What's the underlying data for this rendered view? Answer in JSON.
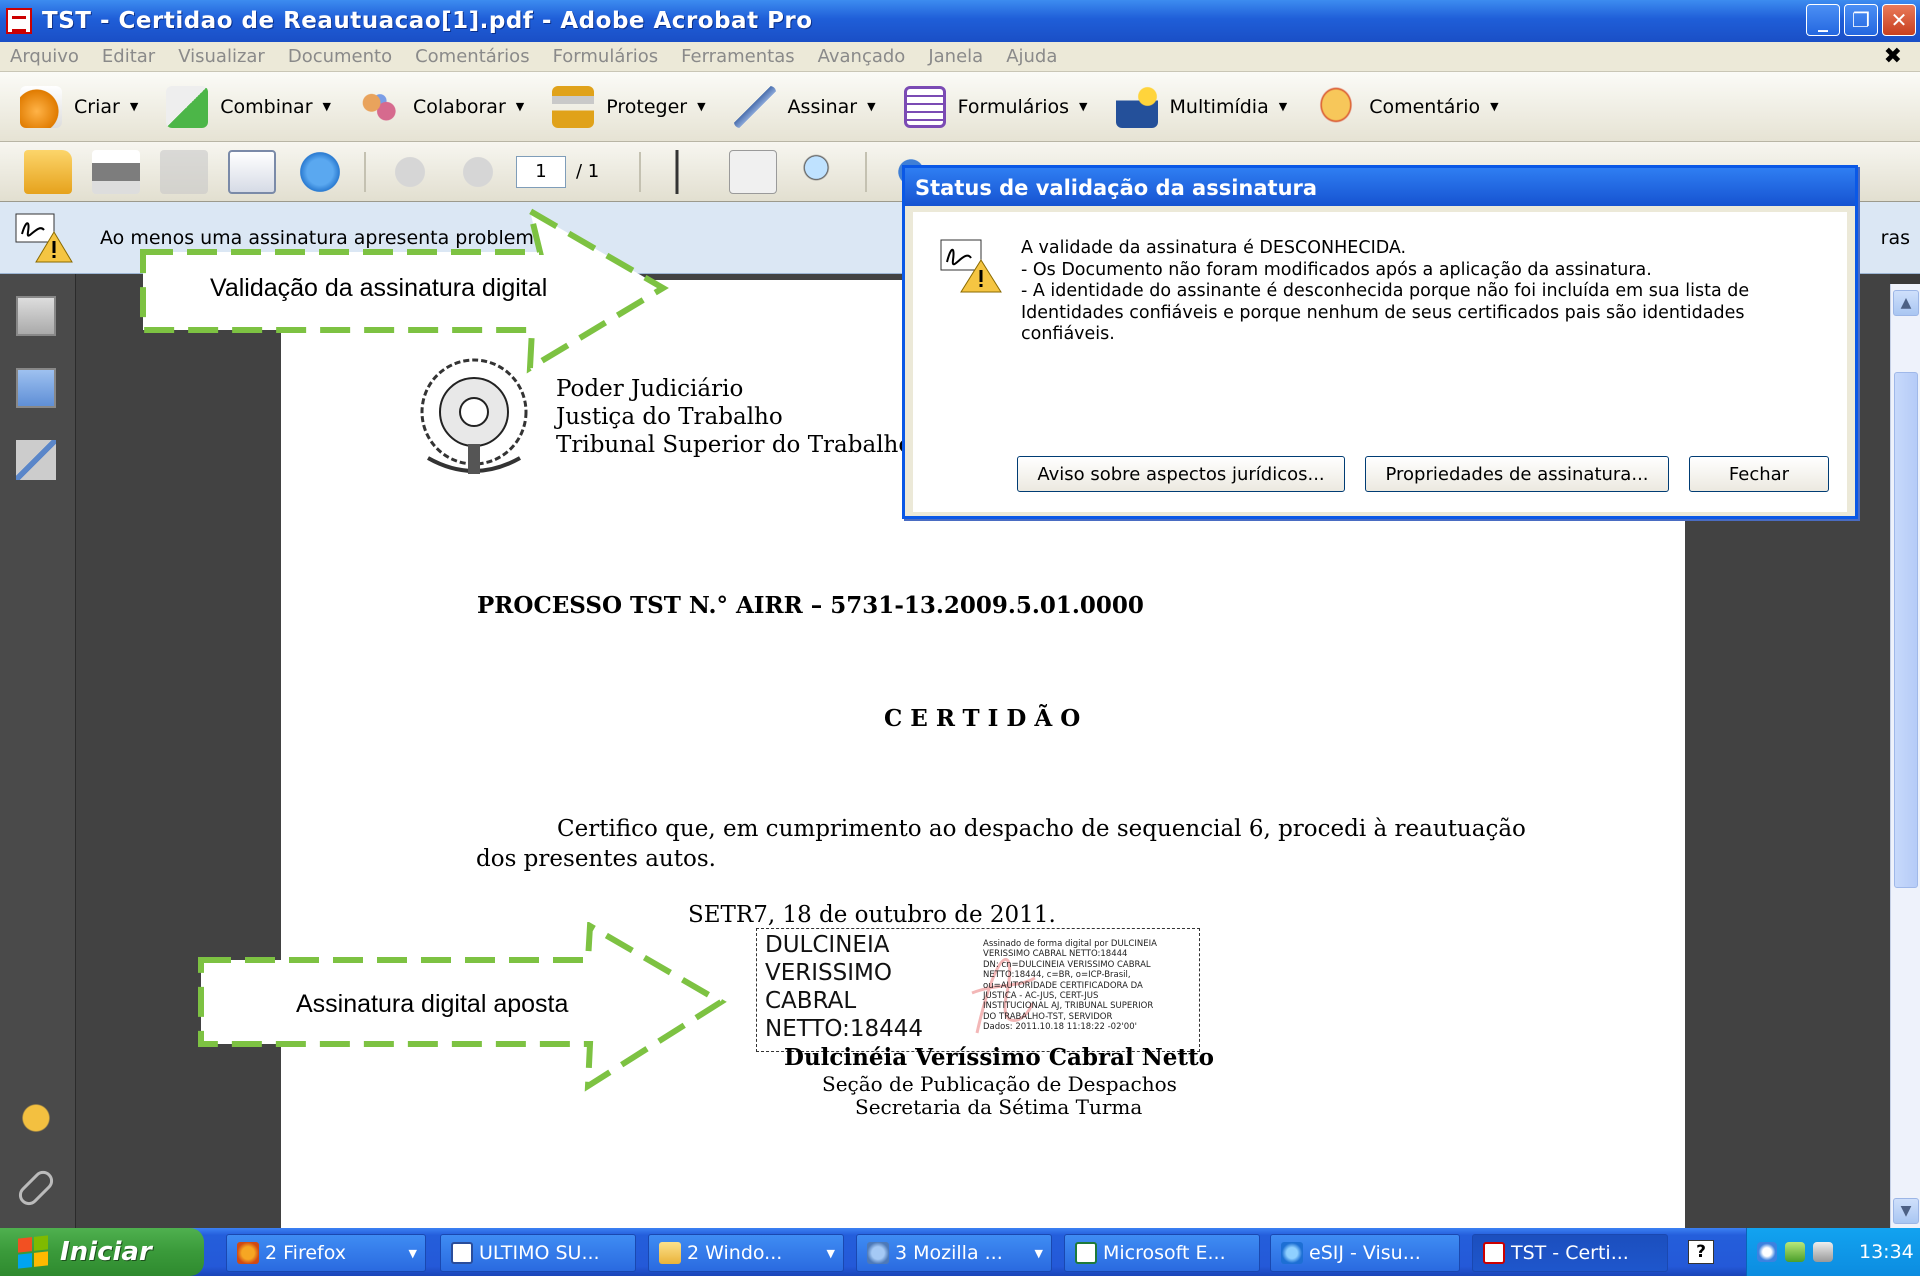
{
  "window": {
    "title": "TST - Certidao de Reautuacao[1].pdf - Adobe Acrobat Pro",
    "minimize": "_",
    "restore": "❐",
    "close": "✕"
  },
  "menu": {
    "items": [
      "Arquivo",
      "Editar",
      "Visualizar",
      "Documento",
      "Comentários",
      "Formulários",
      "Ferramentas",
      "Avançado",
      "Janela",
      "Ajuda"
    ],
    "close_doc": "✖"
  },
  "toolbar": {
    "tasks": [
      {
        "label": "Criar",
        "icon": "create-pdf-icon"
      },
      {
        "label": "Combinar",
        "icon": "combine-files-icon"
      },
      {
        "label": "Colaborar",
        "icon": "collaborate-icon"
      },
      {
        "label": "Proteger",
        "icon": "padlock-icon"
      },
      {
        "label": "Assinar",
        "icon": "pen-icon"
      },
      {
        "label": "Formulários",
        "icon": "forms-icon"
      },
      {
        "label": "Multimídia",
        "icon": "multimedia-icon"
      },
      {
        "label": "Comentário",
        "icon": "comment-bubble-icon"
      }
    ],
    "page_number": "1",
    "page_total": "/ 1"
  },
  "notification": {
    "text": "Ao menos uma assinatura apresenta problemas.",
    "right_text": "ras"
  },
  "document": {
    "header": [
      "Poder Judiciário",
      "Justiça do Trabalho",
      "Tribunal Superior do Trabalho"
    ],
    "process": "PROCESSO TST N.° AIRR – 5731-13.2009.5.01.0000",
    "heading": "CERTIDÃO",
    "body_line1": "Certifico que, em cumprimento ao despacho de sequencial 6, procedi à reautuação",
    "body_line2": "dos presentes autos.",
    "date_line": "SETR7, 18  de outubro de 2011.",
    "signature": {
      "name": "DULCINEIA\nVERISSIMO\nCABRAL\nNETTO:18444",
      "details": "Assinado de forma digital por DULCINEIA\nVERISSIMO CABRAL NETTO:18444\nDN: cn=DULCINEIA VERISSIMO CABRAL\nNETTO:18444, c=BR, o=ICP-Brasil,\nou=AUTORIDADE CERTIFICADORA DA\nJUSTICA - AC-JUS, CERT-JUS\nINSTITUCIONAL AJ, TRIBUNAL SUPERIOR\nDO TRABALHO-TST, SERVIDOR\nDados: 2011.10.18 11:18:22 -02'00'"
    },
    "signer": "Dulcinéia Veríssimo Cabral Netto",
    "section1": "Seção de Publicação de Despachos",
    "section2": "Secretaria da Sétima Turma"
  },
  "callouts": {
    "top": "Validação da assinatura digital",
    "bottom": "Assinatura digital aposta",
    "color": "#7dc242"
  },
  "dialog": {
    "title": "Status de validação da assinatura",
    "line1": "A validade da assinatura é DESCONHECIDA.",
    "line2": "- Os Documento não foram modificados após a aplicação da assinatura.",
    "line3": "- A identidade do assinante é desconhecida porque não foi incluída em sua lista de Identidades confiáveis e porque nenhum de seus certificados pais são identidades confiáveis.",
    "btn_legal": "Aviso sobre aspectos jurídicos...",
    "btn_props": "Propriedades de assinatura...",
    "btn_close": "Fechar"
  },
  "taskbar": {
    "start": "Iniciar",
    "tasks": [
      {
        "label": "2 Firefox",
        "icon": "firefox-icon",
        "group": true
      },
      {
        "label": "ULTIMO SU...",
        "icon": "word-document-icon",
        "group": false
      },
      {
        "label": "2 Windo...",
        "icon": "folder-icon",
        "group": true
      },
      {
        "label": "3 Mozilla ...",
        "icon": "thunderbird-icon",
        "group": true
      },
      {
        "label": "Microsoft E...",
        "icon": "excel-icon",
        "group": false
      },
      {
        "label": "eSIJ - Visu...",
        "icon": "internet-explorer-icon",
        "group": false
      },
      {
        "label": "TST - Certi...",
        "icon": "acrobat-icon",
        "group": false,
        "active": true
      }
    ],
    "clock": "13:34"
  }
}
